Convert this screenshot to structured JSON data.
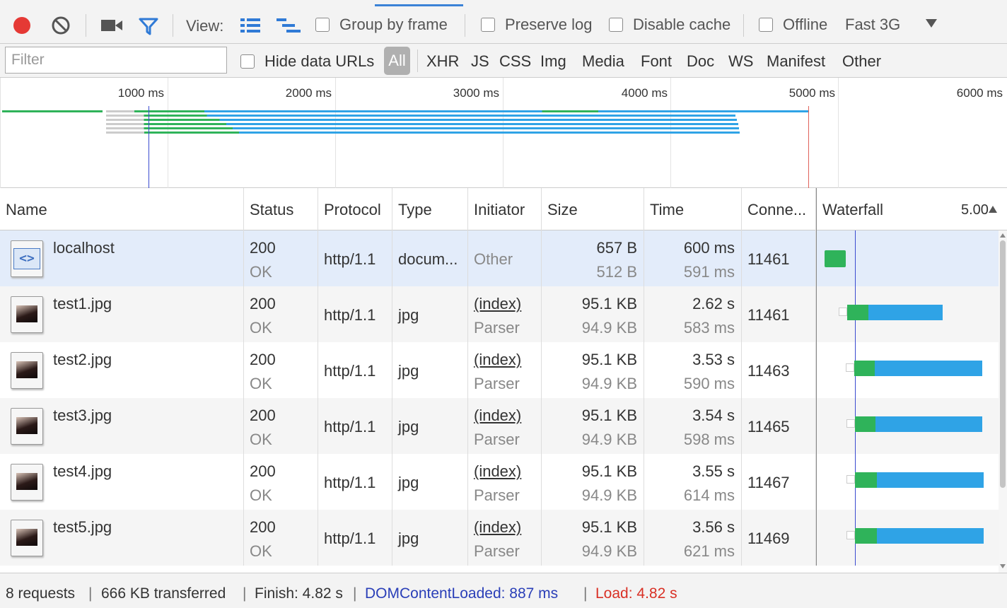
{
  "toolbar": {
    "view_label": "View:",
    "group_by_frame": "Group by frame",
    "preserve_log": "Preserve log",
    "disable_cache": "Disable cache",
    "offline": "Offline",
    "throttle": "Fast 3G",
    "record_color": "#e53935",
    "accent_color": "#3b82d6"
  },
  "filter_bar": {
    "placeholder": "Filter",
    "hide_data_urls": "Hide data URLs",
    "types": [
      "All",
      "XHR",
      "JS",
      "CSS",
      "Img",
      "Media",
      "Font",
      "Doc",
      "WS",
      "Manifest",
      "Other"
    ]
  },
  "overview": {
    "ticks": [
      "1000 ms",
      "2000 ms",
      "3000 ms",
      "4000 ms",
      "5000 ms",
      "6000 ms"
    ]
  },
  "columns": {
    "name": "Name",
    "status": "Status",
    "protocol": "Protocol",
    "type": "Type",
    "initiator": "Initiator",
    "size": "Size",
    "time": "Time",
    "connection": "Conne...",
    "waterfall": "Waterfall",
    "waterfall_scale": "5.00"
  },
  "rows": [
    {
      "name": "localhost",
      "icon": "document-icon",
      "status": "200",
      "status_text": "OK",
      "protocol": "http/1.1",
      "type": "docum...",
      "initiator": "Other",
      "initiator_sub": "",
      "size": "657 B",
      "size_sub": "512 B",
      "time": "600 ms",
      "time_sub": "591 ms",
      "connection": "11461",
      "selected": true
    },
    {
      "name": "test1.jpg",
      "icon": "image-icon",
      "status": "200",
      "status_text": "OK",
      "protocol": "http/1.1",
      "type": "jpg",
      "initiator": "(index)",
      "initiator_sub": "Parser",
      "size": "95.1 KB",
      "size_sub": "94.9 KB",
      "time": "2.62 s",
      "time_sub": "583 ms",
      "connection": "11461",
      "selected": false
    },
    {
      "name": "test2.jpg",
      "icon": "image-icon",
      "status": "200",
      "status_text": "OK",
      "protocol": "http/1.1",
      "type": "jpg",
      "initiator": "(index)",
      "initiator_sub": "Parser",
      "size": "95.1 KB",
      "size_sub": "94.9 KB",
      "time": "3.53 s",
      "time_sub": "590 ms",
      "connection": "11463",
      "selected": false
    },
    {
      "name": "test3.jpg",
      "icon": "image-icon",
      "status": "200",
      "status_text": "OK",
      "protocol": "http/1.1",
      "type": "jpg",
      "initiator": "(index)",
      "initiator_sub": "Parser",
      "size": "95.1 KB",
      "size_sub": "94.9 KB",
      "time": "3.54 s",
      "time_sub": "598 ms",
      "connection": "11465",
      "selected": false
    },
    {
      "name": "test4.jpg",
      "icon": "image-icon",
      "status": "200",
      "status_text": "OK",
      "protocol": "http/1.1",
      "type": "jpg",
      "initiator": "(index)",
      "initiator_sub": "Parser",
      "size": "95.1 KB",
      "size_sub": "94.9 KB",
      "time": "3.55 s",
      "time_sub": "614 ms",
      "connection": "11467",
      "selected": false
    },
    {
      "name": "test5.jpg",
      "icon": "image-icon",
      "status": "200",
      "status_text": "OK",
      "protocol": "http/1.1",
      "type": "jpg",
      "initiator": "(index)",
      "initiator_sub": "Parser",
      "size": "95.1 KB",
      "size_sub": "94.9 KB",
      "time": "3.56 s",
      "time_sub": "621 ms",
      "connection": "11469",
      "selected": false
    }
  ],
  "status_bar": {
    "requests": "8 requests",
    "transferred": "666 KB transferred",
    "finish": "Finish: 4.82 s",
    "dom_content_loaded": "DOMContentLoaded: 887 ms",
    "load": "Load: 4.82 s",
    "dcl_color": "#2a3fb8",
    "load_color": "#d93025"
  },
  "colors": {
    "waiting": "#2fb35a",
    "download": "#2fa3e6",
    "selected_row": "#e3ecfa",
    "alt_row": "#f5f5f5"
  }
}
